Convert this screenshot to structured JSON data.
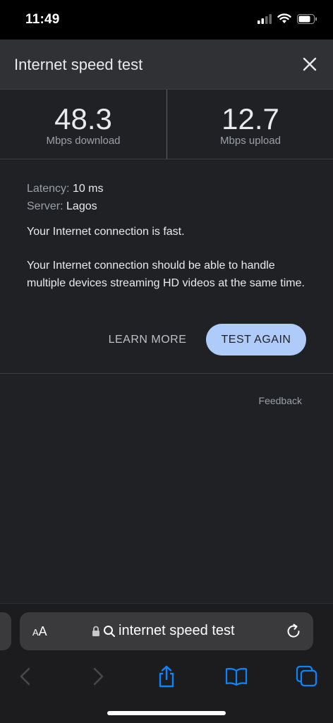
{
  "status_bar": {
    "time": "11:49"
  },
  "header": {
    "title": "Internet speed test"
  },
  "results": {
    "download": {
      "value": "48.3",
      "unit": "Mbps download"
    },
    "upload": {
      "value": "12.7",
      "unit": "Mbps upload"
    }
  },
  "details": {
    "latency_label": "Latency:",
    "latency_value": "10 ms",
    "server_label": "Server:",
    "server_value": "Lagos"
  },
  "summary": "Your Internet connection is fast.",
  "description": "Your Internet connection should be able to handle multiple devices streaming HD videos at the same time.",
  "actions": {
    "learn_more": "LEARN MORE",
    "test_again": "TEST AGAIN"
  },
  "feedback": "Feedback",
  "address_bar": {
    "aa_large": "A",
    "aa_small": "A",
    "url": "internet speed test"
  },
  "colors": {
    "accent_button": "#aecbfa",
    "safari_blue": "#0a84ff"
  }
}
